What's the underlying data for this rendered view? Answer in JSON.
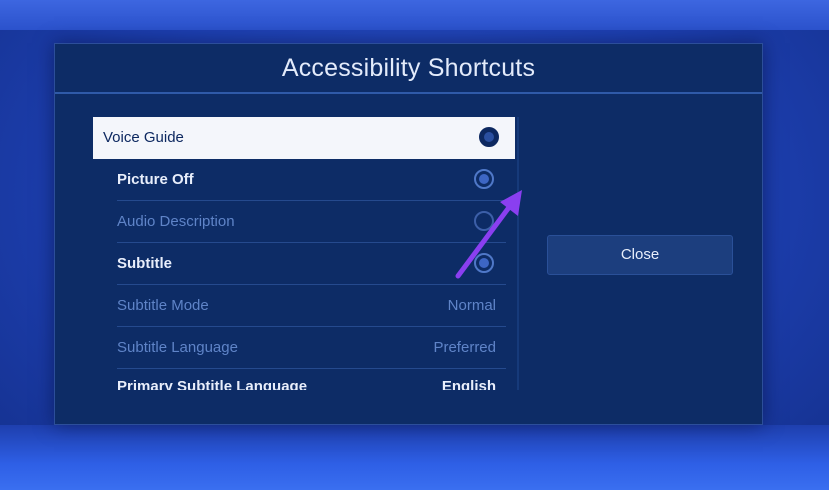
{
  "dialog": {
    "title": "Accessibility Shortcuts"
  },
  "items": [
    {
      "label": "Voice Guide",
      "control": "radio",
      "state": "focused"
    },
    {
      "label": "Picture Off",
      "control": "radio",
      "state": "enabled"
    },
    {
      "label": "Audio Description",
      "control": "radio",
      "state": "disabled"
    },
    {
      "label": "Subtitle",
      "control": "radio",
      "state": "enabled"
    },
    {
      "label": "Subtitle Mode",
      "value": "Normal",
      "state": "disabled"
    },
    {
      "label": "Subtitle Language",
      "value": "Preferred",
      "state": "disabled"
    },
    {
      "label": "Primary Subtitle Language",
      "value": "English",
      "state": "partially-visible"
    }
  ],
  "close_button": {
    "label": "Close"
  },
  "annotation": {
    "icon": "arrow-annotation-icon",
    "color": "#8a3ff0"
  },
  "colors": {
    "background": "#1d3fb0",
    "dialog": "#0d2c66",
    "focus_highlight": "#f4f6fb",
    "dim_text": "#5f84c8"
  }
}
